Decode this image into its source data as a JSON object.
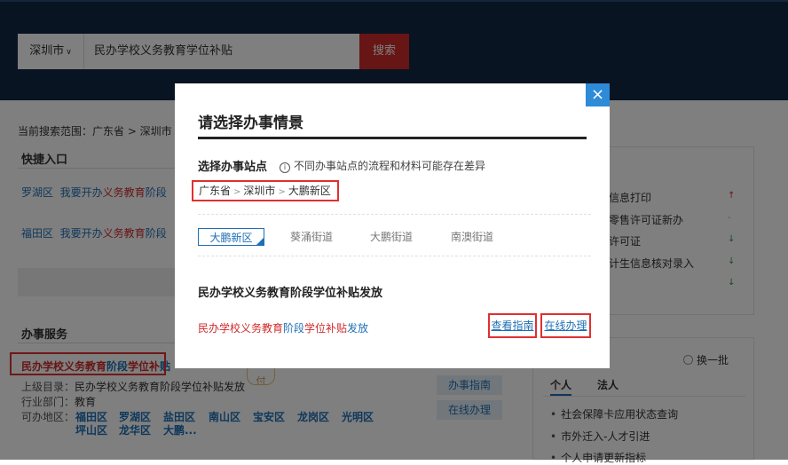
{
  "header": {
    "city": "深圳市",
    "query": "民办学校义务教育学位补贴",
    "search_label": "搜索"
  },
  "scope": "当前搜索范围：广东省 > 深圳市",
  "quick_entry": {
    "title": "快捷入口",
    "rows": [
      {
        "district": "罗湖区",
        "p1": "我要开办",
        "h1": "义务教育",
        "p2": "阶段"
      },
      {
        "district": "福田区",
        "p1": "我要开办",
        "h1": "义务教育",
        "p2": "阶段"
      }
    ]
  },
  "service": {
    "title": "办事服务",
    "item": {
      "h1": "民办学校义务教育",
      "b1": "阶段",
      "h2": "学位补",
      "b2": "贴"
    },
    "badge": "付",
    "parent_label": "上级目录：",
    "parent_value": "民办学校义务教育阶段学位补贴发放",
    "dept_label": "行业部门：",
    "dept_value": "教育",
    "area_label": "可办地区：",
    "areas_row1": [
      "福田区",
      "罗湖区",
      "盐田区",
      "南山区",
      "宝安区",
      "龙岗区",
      "光明区"
    ],
    "areas_row2": [
      "坪山区",
      "龙华区",
      "大鹏..."
    ],
    "guide_btn": "办事指南",
    "online_btn": "在线办理"
  },
  "right_panel": {
    "items": [
      "信息打印",
      "零售许可证新办",
      "许可证",
      "计生信息核对录入"
    ],
    "arrows": [
      "↑",
      "-",
      "↓",
      "↓",
      "↓"
    ],
    "arrow_colors": [
      "#d02a2a",
      "#c9a04c",
      "#2a9a40",
      "#2a9a40",
      "#2a9a40"
    ]
  },
  "hot_panel": {
    "refresh": "换一批",
    "tab_person": "个人",
    "tab_corp": "法人",
    "items": [
      "社会保障卡应用状态查询",
      "市外迁入-人才引进",
      "个人申请更新指标"
    ]
  },
  "modal": {
    "title": "请选择办事情景",
    "station_label": "选择办事站点",
    "info_icon": "i",
    "info_text": "不同办事站点的流程和材料可能存在差异",
    "crumb": [
      "广东省",
      "深圳市",
      "大鹏新区"
    ],
    "crumb_sep": ">",
    "stations": [
      "大鹏新区",
      "葵涌街道",
      "大鹏街道",
      "南澳街道"
    ],
    "section_title": "民办学校义务教育阶段学位补贴发放",
    "item": {
      "h1": "民办学校义务教育",
      "b1": "阶段",
      "h2": "学位补贴",
      "b2": "发放"
    },
    "guide_btn": "查看指南",
    "online_btn": "在线办理",
    "close": "×"
  },
  "colors": {
    "header_bg": "#122846",
    "search_btn": "#d02a2a",
    "accent_blue": "#1e6fb5",
    "highlight_red": "#e03030"
  }
}
